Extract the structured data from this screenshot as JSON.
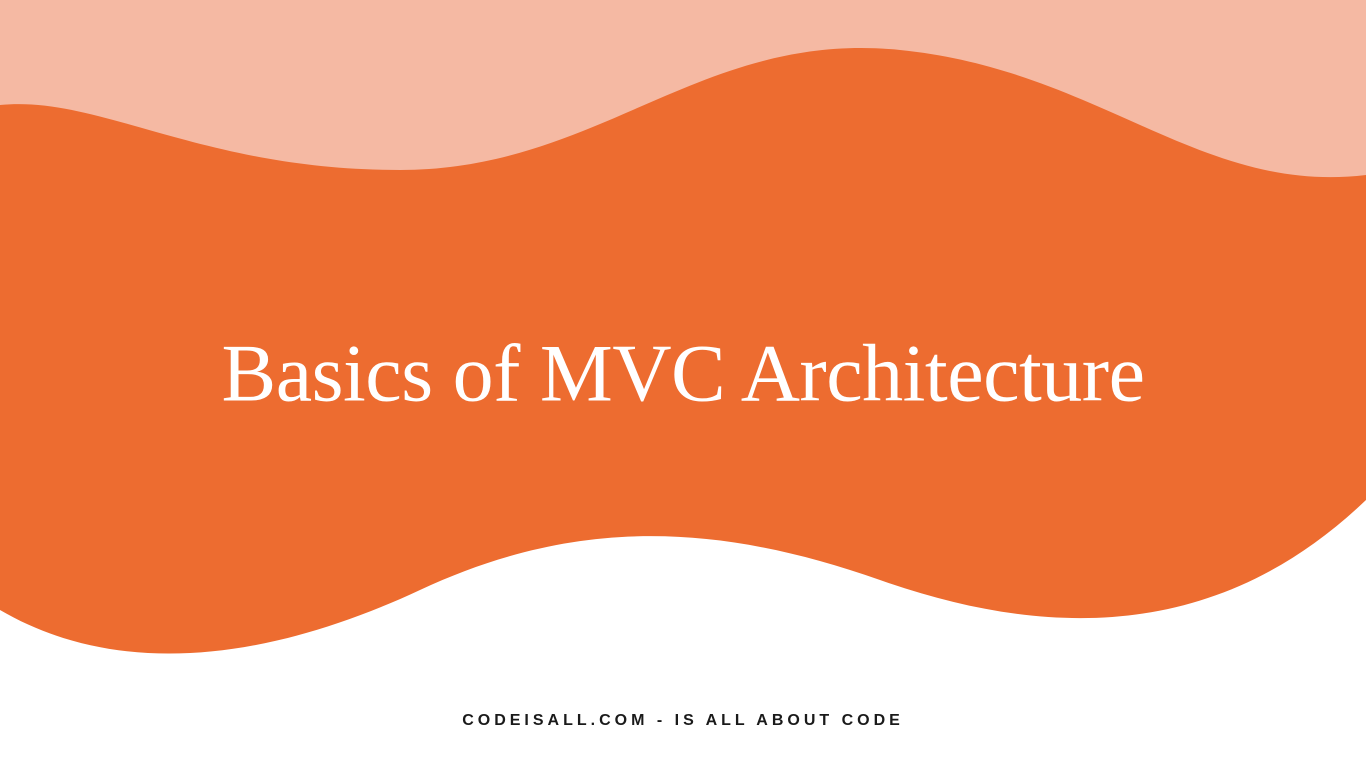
{
  "title": "Basics of MVC Architecture",
  "footer": "CODEISALL.COM - IS ALL ABOUT  CODE",
  "colors": {
    "light_orange": "#f5b9a3",
    "orange": "#ed6c30",
    "white": "#ffffff",
    "text_dark": "#1a1a1a"
  }
}
